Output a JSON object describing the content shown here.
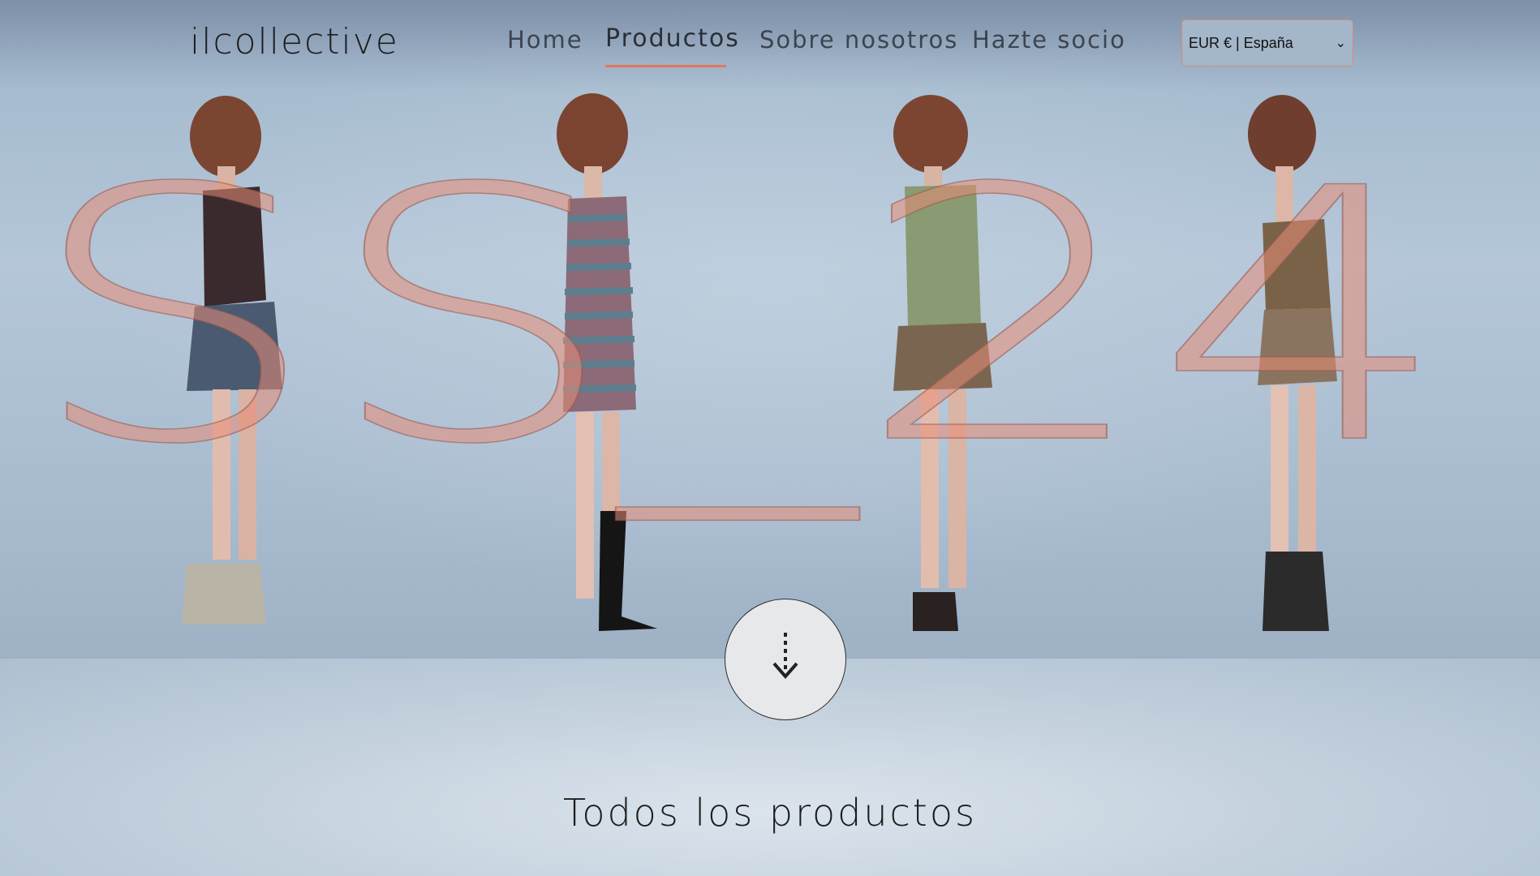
{
  "brand": {
    "logo_text": "ilcollective"
  },
  "nav": {
    "items": [
      {
        "label": "Home",
        "active": false
      },
      {
        "label": "Productos",
        "active": true
      },
      {
        "label": "Sobre nosotros",
        "active": false
      },
      {
        "label": "Hazte socio",
        "active": false
      }
    ],
    "accent_color": "#e07a5b"
  },
  "currency_select": {
    "value": "EUR € | España"
  },
  "hero": {
    "overlay_text": "SS_24",
    "overlay_color": "#e88c76",
    "scroll_button_icon": "dashed-arrow-down-icon"
  },
  "section": {
    "title": "Todos los productos"
  }
}
